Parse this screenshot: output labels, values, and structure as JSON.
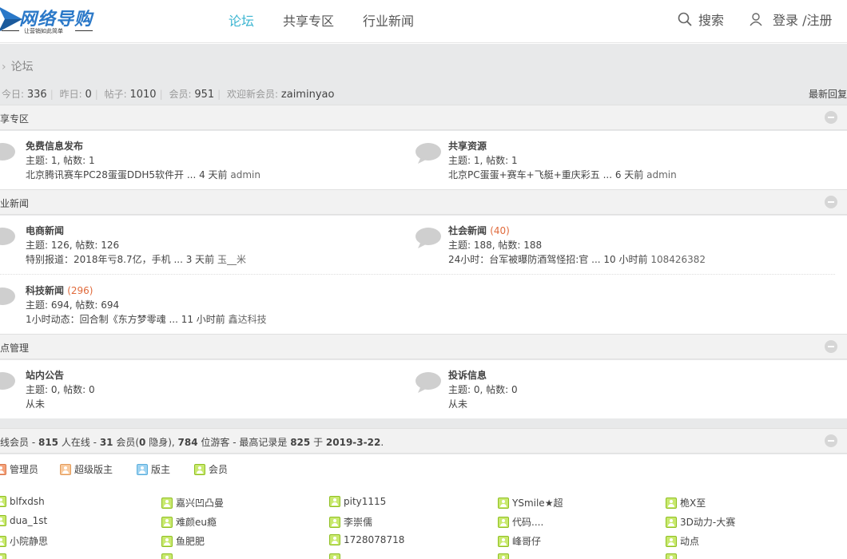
{
  "header": {
    "logo_name": "网络导购",
    "logo_slogan": "让营销如此简单",
    "nav": [
      "论坛",
      "共享专区",
      "行业新闻"
    ],
    "search": "搜索",
    "login": "登录 /注册"
  },
  "breadcrumb": {
    "current": "论坛"
  },
  "stats": {
    "today_label": "今日:",
    "today": "336",
    "yesterday_label": "昨日:",
    "yesterday": "0",
    "posts_label": "帖子:",
    "posts": "1010",
    "members_label": "会员:",
    "members": "951",
    "newest_label": "欢迎新会员:",
    "newest": "zaiminyao",
    "latest_link": "最新回复"
  },
  "categories": [
    {
      "title": "共享专区",
      "forums": [
        {
          "name": "免费信息发布",
          "new": "",
          "counts": "主题: 1, 帖数: 1",
          "last": "北京腾讯赛车PC28蛋蛋DDH5软件开 ... 4 天前",
          "who": "admin"
        },
        {
          "name": "共享资源",
          "new": "",
          "counts": "主题: 1, 帖数: 1",
          "last": "北京PC蛋蛋+赛车+飞艇+重庆彩五 ... 6 天前",
          "who": "admin"
        }
      ]
    },
    {
      "title": "行业新闻",
      "forums": [
        {
          "name": "电商新闻",
          "new": "",
          "counts": "主题: 126, 帖数: 126",
          "last": "特别报道：2018年亏8.7亿，手机 ... 3 天前",
          "who": "玉__米"
        },
        {
          "name": "社会新闻",
          "new": "(40)",
          "counts": "主题: 188, 帖数: 188",
          "last": "24小时：台军被曝防酒驾怪招:官 ... 10 小时前",
          "who": "108426382"
        },
        {
          "name": "科技新闻",
          "new": "(296)",
          "counts": "主题: 694, 帖数: 694",
          "last": "1小时动态：回合制《东方梦零魂 ... 11 小时前",
          "who": "鑫达科技"
        }
      ]
    },
    {
      "title": "站点管理",
      "forums": [
        {
          "name": "站内公告",
          "new": "",
          "counts": "主题: 0, 帖数: 0",
          "last": "从未",
          "who": ""
        },
        {
          "name": "投诉信息",
          "new": "",
          "counts": "主题: 0, 帖数: 0",
          "last": "从未",
          "who": ""
        }
      ]
    }
  ],
  "online": {
    "title": "在线会员",
    "total": "815",
    "members": "31",
    "hidden": "0",
    "guests": "784",
    "record": "825",
    "record_date": "2019-3-22",
    "t1": " - ",
    "t2": " 人在线 - ",
    "t3": " 会员(",
    "t4": " 隐身), ",
    "t5": " 位游客 - 最高记录是 ",
    "t6": " 于 ",
    "t7": ".",
    "legend": [
      "管理员",
      "超级版主",
      "版主",
      "会员"
    ],
    "users": [
      "blfxdsh",
      "嘉兴凹凸曼",
      "pity1115",
      "YSmile★超",
      "桅X至",
      "dua_1st",
      "难颜eu瘾",
      "李崇儒",
      "代码....",
      "3D动力-大赛",
      "小院静思",
      "鱼肥肥",
      "1728078718",
      "峰哥仔",
      "动点",
      "…",
      "…",
      "…",
      "…",
      "…"
    ]
  },
  "colors": {
    "accent": "#3bb5d1",
    "new_count": "#e06a3b",
    "logo": "#2a78c8"
  }
}
